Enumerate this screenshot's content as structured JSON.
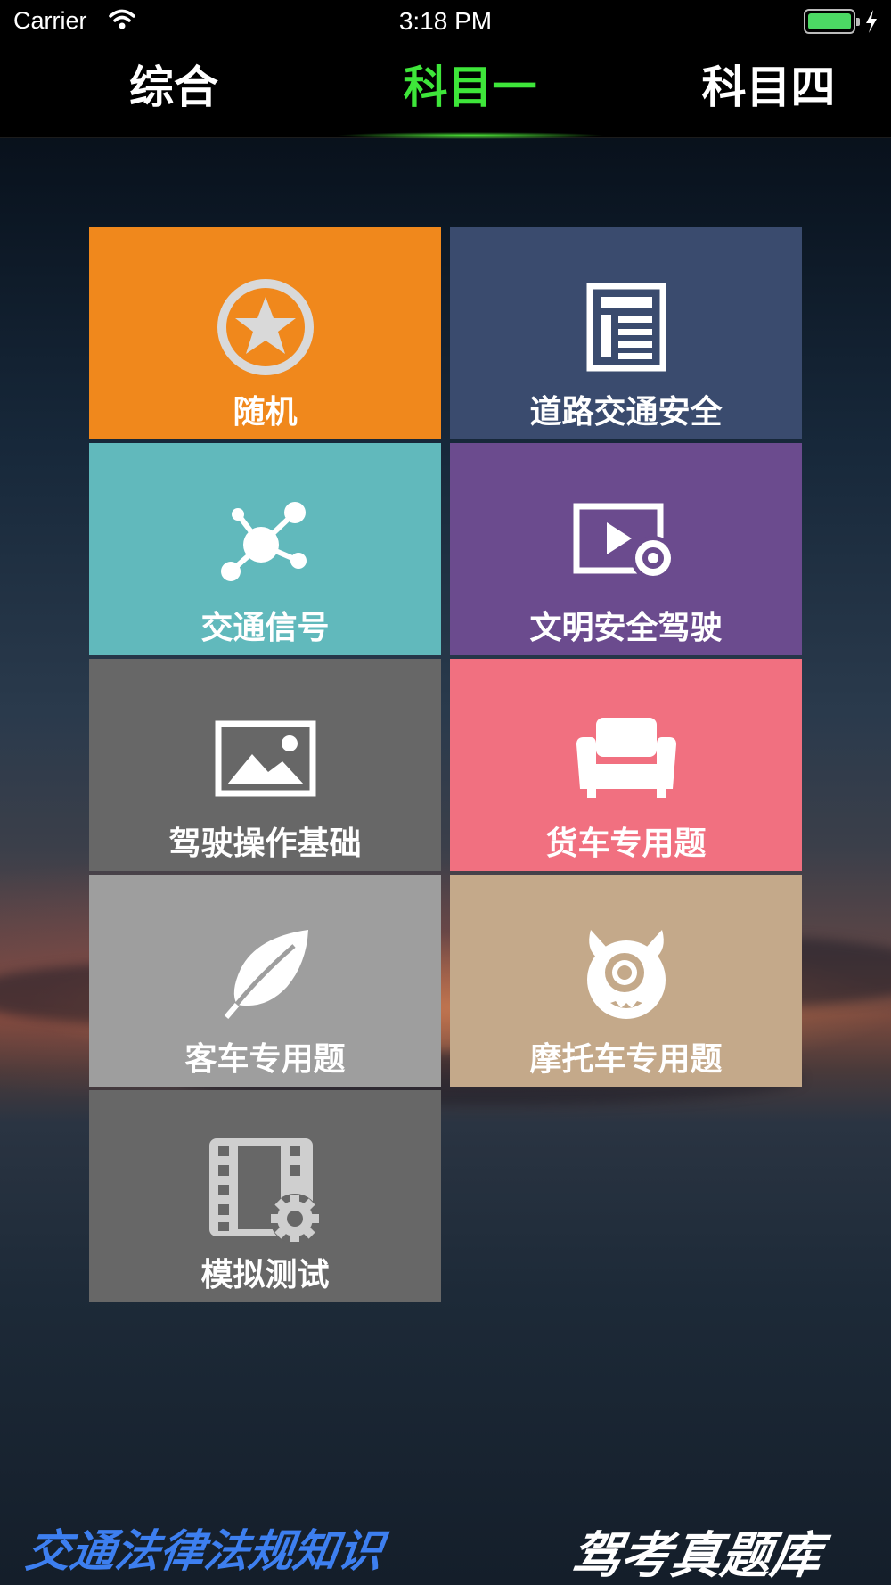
{
  "status_bar": {
    "carrier": "Carrier",
    "time": "3:18 PM"
  },
  "tabs": [
    {
      "label": "综合",
      "selected": false
    },
    {
      "label": "科目一",
      "selected": true
    },
    {
      "label": "科目四",
      "selected": false
    }
  ],
  "active_tab_color": "#3ee63a",
  "tiles": [
    {
      "label": "随机",
      "icon": "star-badge-icon",
      "color": "#f0881c"
    },
    {
      "label": "道路交通安全",
      "icon": "document-icon",
      "color": "#3a4b6e"
    },
    {
      "label": "交通信号",
      "icon": "network-nodes-icon",
      "color": "#61b9bc"
    },
    {
      "label": "文明安全驾驶",
      "icon": "video-settings-icon",
      "color": "#6b4b8e"
    },
    {
      "label": "驾驶操作基础",
      "icon": "picture-icon",
      "color": "#676767"
    },
    {
      "label": "货车专用题",
      "icon": "armchair-icon",
      "color": "#f17080"
    },
    {
      "label": "客车专用题",
      "icon": "feather-icon",
      "color": "#9e9e9e"
    },
    {
      "label": "摩托车专用题",
      "icon": "monster-icon",
      "color": "#c4a98a"
    },
    {
      "label": "模拟测试",
      "icon": "film-gear-icon",
      "color": "#676767"
    }
  ],
  "footer": {
    "left": "交通法律法规知识",
    "right": "驾考真题库",
    "left_color": "#3d7ff0"
  }
}
